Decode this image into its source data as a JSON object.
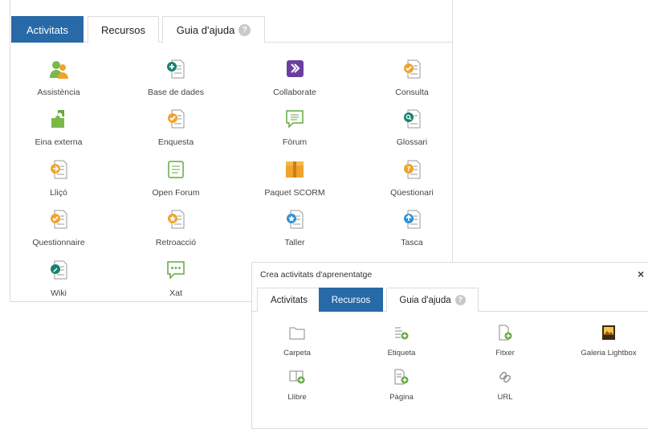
{
  "back_panel": {
    "tabs": [
      {
        "label": "Activitats",
        "active": true
      },
      {
        "label": "Recursos",
        "active": false
      },
      {
        "label": "Guia d'ajuda",
        "active": false
      }
    ],
    "help_glyph": "?",
    "activities": [
      {
        "label": "Assistència",
        "icon": "attendance-icon"
      },
      {
        "label": "Base de dades",
        "icon": "database-icon"
      },
      {
        "label": "Collaborate",
        "icon": "collaborate-icon"
      },
      {
        "label": "Consulta",
        "icon": "choice-icon"
      },
      {
        "label": "Eina externa",
        "icon": "external-tool-icon"
      },
      {
        "label": "Enquesta",
        "icon": "survey-icon"
      },
      {
        "label": "Fòrum",
        "icon": "forum-icon"
      },
      {
        "label": "Glossari",
        "icon": "glossary-icon"
      },
      {
        "label": "Lliçó",
        "icon": "lesson-icon"
      },
      {
        "label": "Open Forum",
        "icon": "open-forum-icon"
      },
      {
        "label": "Paquet SCORM",
        "icon": "scorm-package-icon"
      },
      {
        "label": "Qüestionari",
        "icon": "quiz-icon"
      },
      {
        "label": "Questionnaire",
        "icon": "questionnaire-icon"
      },
      {
        "label": "Retroacció",
        "icon": "feedback-icon"
      },
      {
        "label": "Taller",
        "icon": "workshop-icon"
      },
      {
        "label": "Tasca",
        "icon": "assignment-icon"
      },
      {
        "label": "Wiki",
        "icon": "wiki-icon"
      },
      {
        "label": "Xat",
        "icon": "chat-icon"
      }
    ]
  },
  "front_modal": {
    "title": "Crea activitats d'aprenentatge",
    "close_glyph": "×",
    "tabs": [
      {
        "label": "Activitats",
        "active": false
      },
      {
        "label": "Recursos",
        "active": true
      },
      {
        "label": "Guia d'ajuda",
        "active": false
      }
    ],
    "help_glyph": "?",
    "resources": [
      {
        "label": "Carpeta",
        "icon": "folder-icon"
      },
      {
        "label": "Etiqueta",
        "icon": "label-icon"
      },
      {
        "label": "Fitxer",
        "icon": "file-icon"
      },
      {
        "label": "Galeria Lightbox",
        "icon": "lightbox-gallery-icon"
      },
      {
        "label": "Llibre",
        "icon": "book-icon"
      },
      {
        "label": "Pàgina",
        "icon": "page-icon"
      },
      {
        "label": "URL",
        "icon": "url-link-icon"
      }
    ]
  },
  "colors": {
    "tab_active": "#2869a8",
    "orange": "#f0a32b",
    "green": "#62a83e",
    "blue": "#2c8fd6",
    "teal": "#16826f",
    "purple": "#6a3fa1"
  }
}
